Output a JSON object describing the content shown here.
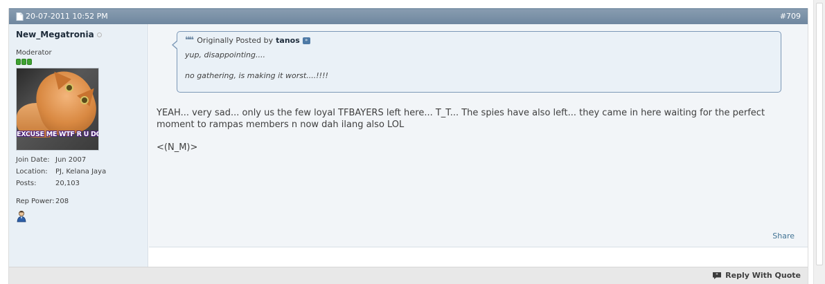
{
  "post": {
    "date": "20-07-2011 10:52 PM",
    "number": "#709"
  },
  "user": {
    "name": "New_Megatronia",
    "title": "Moderator",
    "avatar_caption": "EXCUSE ME WTF R U DOIN",
    "stats": [
      {
        "label": "Join Date:",
        "value": "Jun 2007"
      },
      {
        "label": "Location:",
        "value": "PJ, Kelana Jaya"
      },
      {
        "label": "Posts:",
        "value": "20,103"
      }
    ],
    "rep_power_label": "Rep Power:",
    "rep_power_value": "208",
    "rep_level": 3
  },
  "quote": {
    "prefix": "Originally Posted by",
    "author": "tanos",
    "lines": [
      "yup, disappointing....",
      "no gathering, is making it worst....!!!!"
    ]
  },
  "message": {
    "text": "YEAH... very sad... only us the few loyal TFBAYERS left here... T_T... The spies have also left... they came in here waiting for the perfect moment to rampas members n now dah ilang also LOL",
    "signature": "<(N_M)>"
  },
  "actions": {
    "share": "Share",
    "reply_with_quote": "Reply With Quote"
  },
  "colors": {
    "header_bar": "#7890a8",
    "userinfo_bg": "#e9f0f6",
    "content_bg": "#f2f5f8",
    "link": "#417394",
    "rep_green": "#3fa232"
  }
}
